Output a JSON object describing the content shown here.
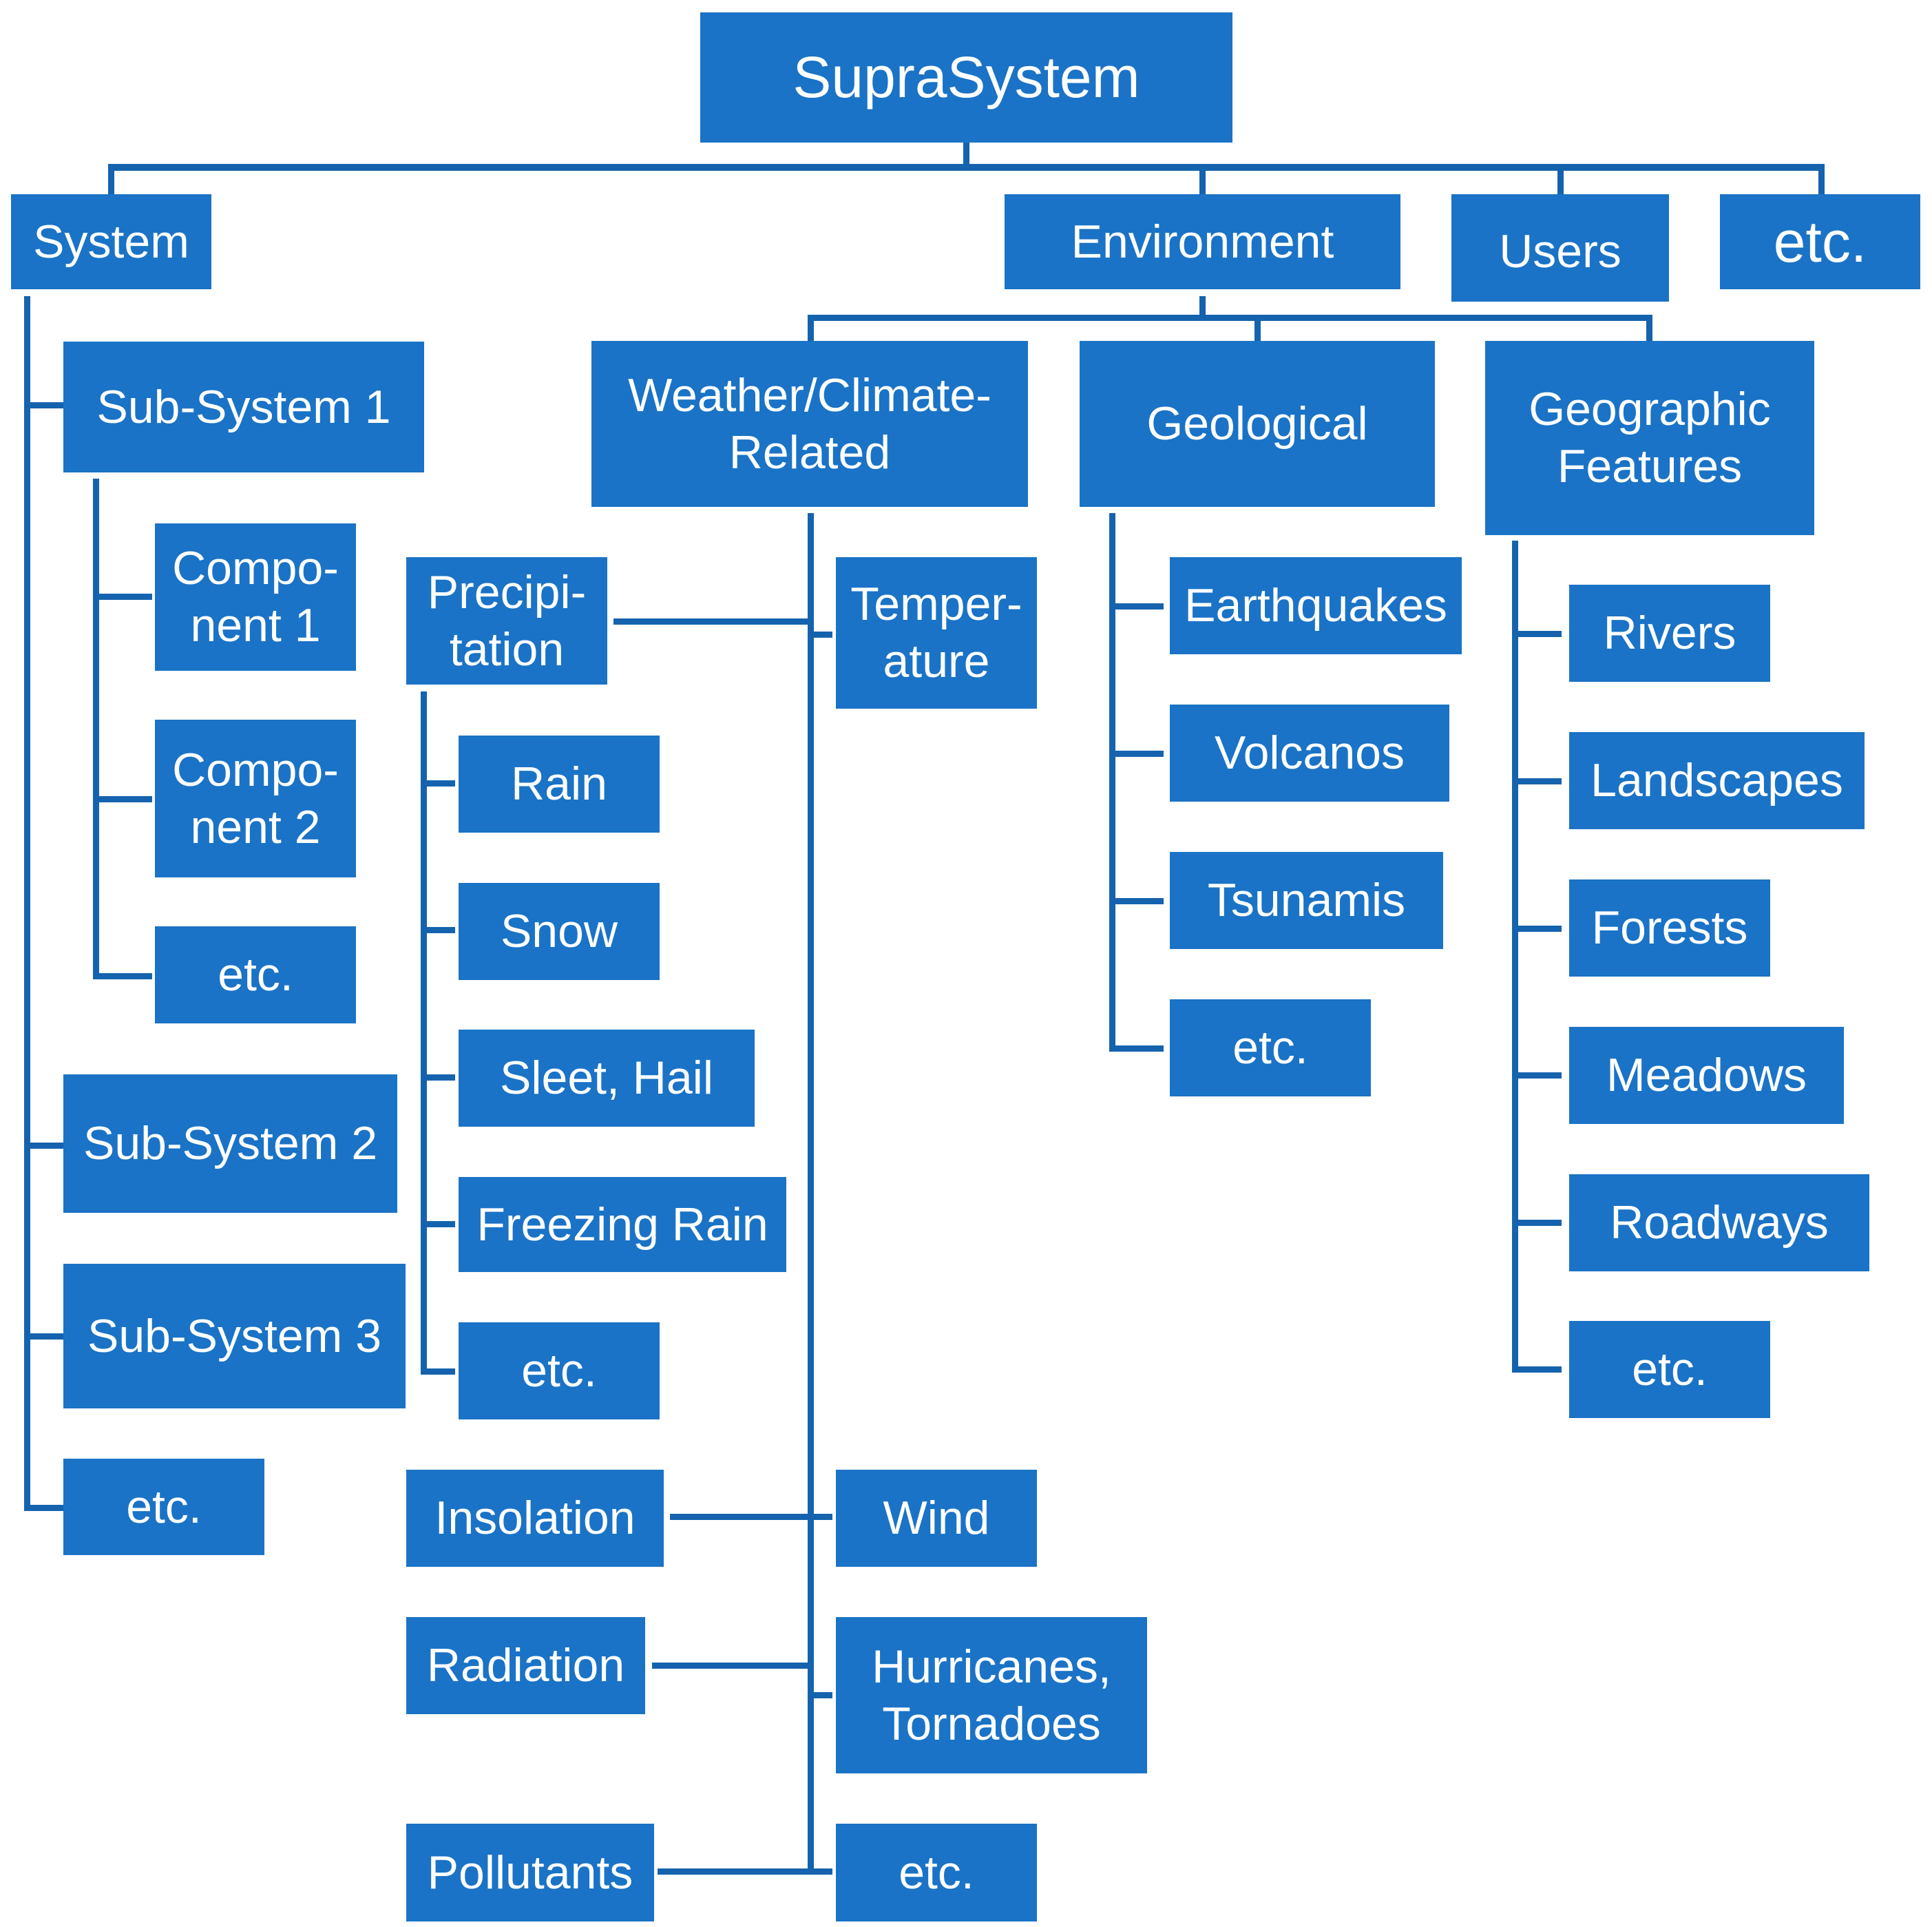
{
  "diagram": {
    "colors": {
      "box_fill": "#1a73c6",
      "connector": "#1563ae",
      "text": "#ffffff"
    },
    "root": {
      "label": "SupraSystem"
    },
    "level1": {
      "system": "System",
      "environment": "Environment",
      "users": "Users",
      "etc": "etc."
    },
    "system_children": {
      "sub1": "Sub-System 1",
      "comp1": "Compo-\nnent 1",
      "comp2": "Compo-\nnent 2",
      "comp_etc": "etc.",
      "sub2": "Sub-System 2",
      "sub3": "Sub-System 3",
      "sub_etc": "etc."
    },
    "environment_children": {
      "weather": "Weather/Climate-\nRelated",
      "geological": "Geological",
      "geographic": "Geographic\nFeatures"
    },
    "weather_children": {
      "precipitation": "Precipi-\ntation",
      "rain": "Rain",
      "snow": "Snow",
      "sleet": "Sleet, Hail",
      "freezing": "Freezing Rain",
      "precip_etc": "etc.",
      "temperature": "Temper-\nature",
      "insolation": "Insolation",
      "wind": "Wind",
      "radiation": "Radiation",
      "hurricanes": "Hurricanes,\nTornadoes",
      "pollutants": "Pollutants",
      "weather_etc": "etc."
    },
    "geological_children": {
      "earthquakes": "Earthquakes",
      "volcanos": "Volcanos",
      "tsunamis": "Tsunamis",
      "geo_etc": "etc."
    },
    "geographic_children": {
      "rivers": "Rivers",
      "landscapes": "Landscapes",
      "forests": "Forests",
      "meadows": "Meadows",
      "roadways": "Roadways",
      "geog_etc": "etc."
    }
  }
}
